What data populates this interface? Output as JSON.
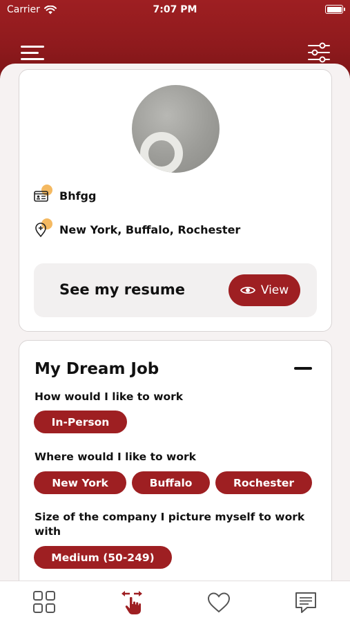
{
  "status_bar": {
    "carrier": "Carrier",
    "time": "7:07 PM"
  },
  "profile": {
    "name": "Bhfgg",
    "locations": "New York, Buffalo, Rochester",
    "resume_prompt": "See my resume",
    "view_label": "View"
  },
  "dream_job": {
    "title": "My Dream Job",
    "how_label": "How would I like to work",
    "how_chips": [
      "In-Person"
    ],
    "where_label": "Where would I like to work",
    "where_chips": [
      "New York",
      "Buffalo",
      "Rochester"
    ],
    "size_label": "Size of the company I picture myself to work with",
    "size_chips": [
      "Medium (50-249)"
    ]
  },
  "colors": {
    "brand": "#9e1f22",
    "accent": "#f4b961"
  },
  "icons": {
    "menu": "hamburger-icon",
    "filter": "sliders-icon",
    "tabs": [
      "grid-icon",
      "swipe-hand-icon",
      "heart-icon",
      "chat-icon"
    ]
  }
}
